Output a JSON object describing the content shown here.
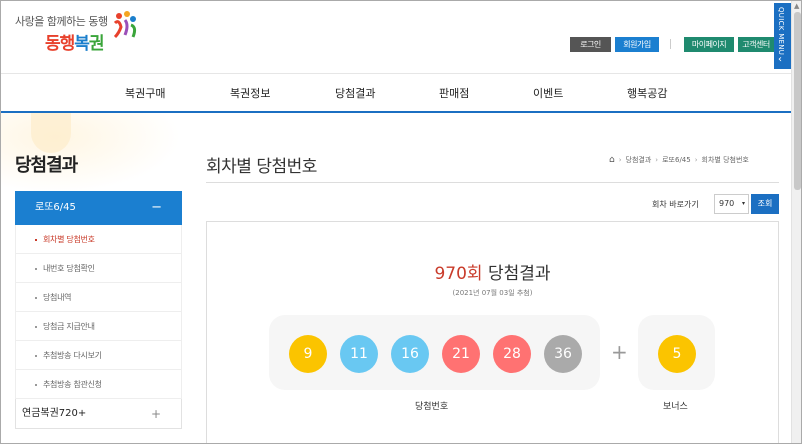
{
  "header": {
    "slogan": "사랑을 함께하는 동행",
    "brand_part1": "동행",
    "brand_part2": "복",
    "brand_part3": "권",
    "utils": [
      {
        "label": "로그인",
        "color": "#555555"
      },
      {
        "label": "회원가입",
        "color": "#1b7fd0"
      },
      {
        "label": "마이페이지",
        "color": "#1f8a6f"
      },
      {
        "label": "고객센터",
        "color": "#1f8a6f"
      }
    ],
    "quick_menu": "QUICK MENU",
    "quick_arrow": "‹"
  },
  "nav": [
    "복권구매",
    "복권정보",
    "당첨결과",
    "판매점",
    "이벤트",
    "행복공감"
  ],
  "sidebar": {
    "title": "당첨결과",
    "active_group": "로또6/45",
    "active_toggle": "−",
    "items": [
      "회차별 당첨번호",
      "내번호 당첨확인",
      "당첨내역",
      "당첨금 지급안내",
      "추첨방송 다시보기",
      "추첨방송 참관신청"
    ],
    "next_group": "연금복권720+",
    "next_toggle": "+"
  },
  "main": {
    "title": "회차별 당첨번호",
    "breadcrumb_home": "⌂",
    "breadcrumb": [
      "당첨결과",
      "로또6/45",
      "회차별 당첨번호"
    ],
    "breadcrumb_sep": "›",
    "goto_label": "회차 바로가기",
    "goto_value": "970",
    "goto_caret": "▾",
    "goto_button": "조회"
  },
  "result": {
    "round": "970회",
    "title_suffix": " 당첨결과",
    "date": "(2021년 07월 03일 추첨)",
    "numbers": [
      {
        "value": "9",
        "color": "#fbc400"
      },
      {
        "value": "11",
        "color": "#69c8f2"
      },
      {
        "value": "16",
        "color": "#69c8f2"
      },
      {
        "value": "21",
        "color": "#ff7272"
      },
      {
        "value": "28",
        "color": "#ff7272"
      },
      {
        "value": "36",
        "color": "#aaaaaa"
      }
    ],
    "plus": "+",
    "bonus": {
      "value": "5",
      "color": "#fbc400"
    },
    "label_numbers": "당첨번호",
    "label_bonus": "보너스"
  }
}
